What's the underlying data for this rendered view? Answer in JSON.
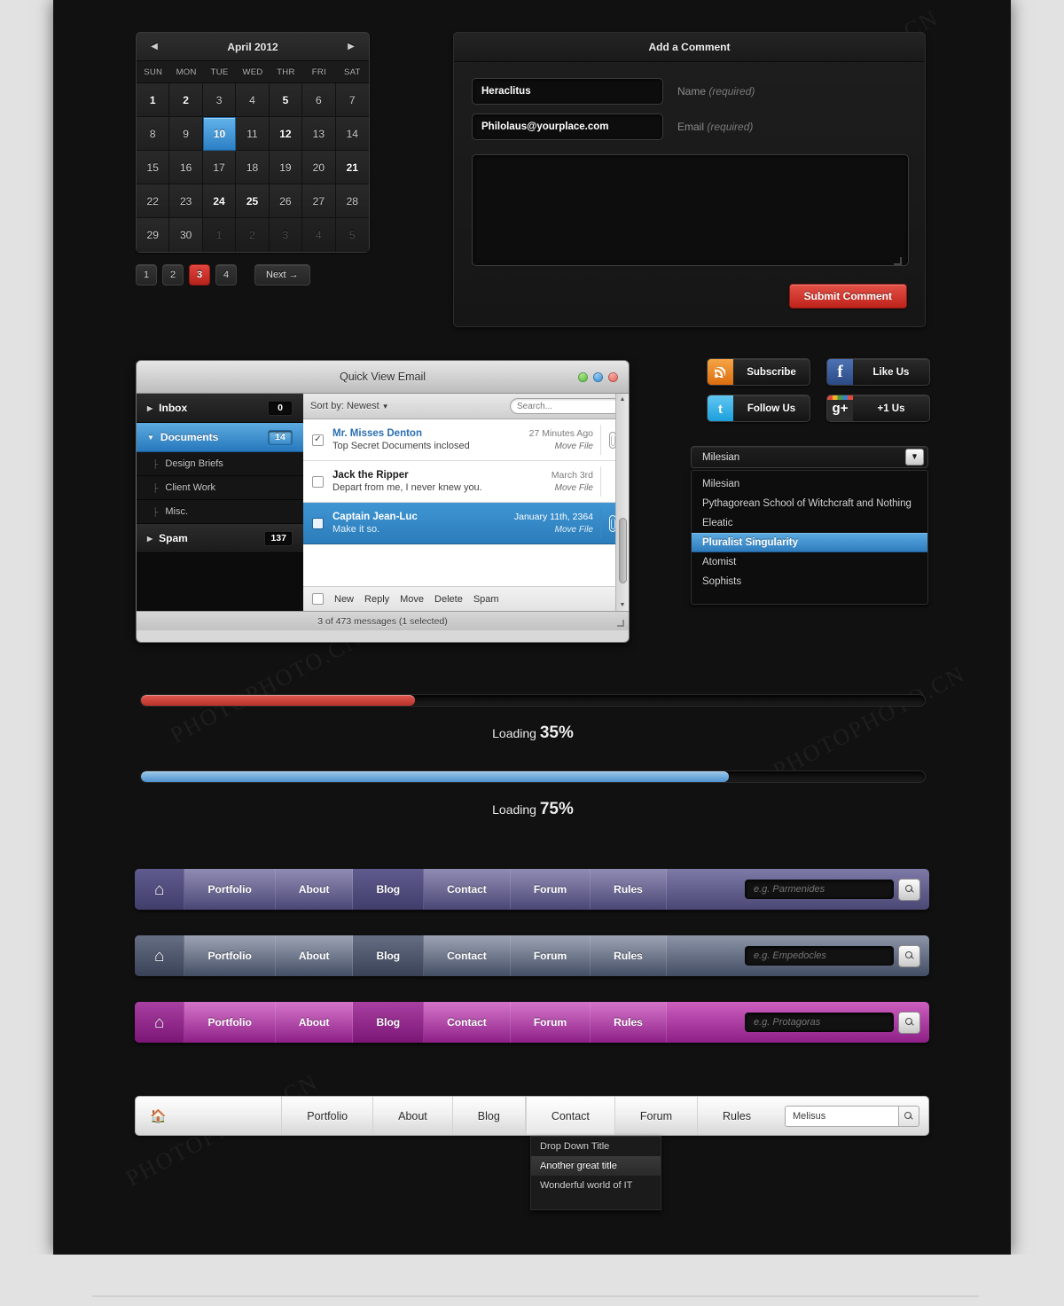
{
  "calendar": {
    "prev_icon": "triangle-left-icon",
    "next_icon": "triangle-right-icon",
    "title": "April 2012",
    "day_headers": [
      "SUN",
      "MON",
      "TUE",
      "WED",
      "THR",
      "FRI",
      "SAT"
    ],
    "weeks": [
      [
        {
          "d": "1",
          "s": "bold"
        },
        {
          "d": "2",
          "s": "bold"
        },
        {
          "d": "3",
          "s": ""
        },
        {
          "d": "4",
          "s": ""
        },
        {
          "d": "5",
          "s": "bold"
        },
        {
          "d": "6",
          "s": ""
        },
        {
          "d": "7",
          "s": ""
        }
      ],
      [
        {
          "d": "8",
          "s": ""
        },
        {
          "d": "9",
          "s": ""
        },
        {
          "d": "10",
          "s": "sel"
        },
        {
          "d": "11",
          "s": ""
        },
        {
          "d": "12",
          "s": "bold"
        },
        {
          "d": "13",
          "s": ""
        },
        {
          "d": "14",
          "s": ""
        }
      ],
      [
        {
          "d": "15",
          "s": ""
        },
        {
          "d": "16",
          "s": ""
        },
        {
          "d": "17",
          "s": ""
        },
        {
          "d": "18",
          "s": ""
        },
        {
          "d": "19",
          "s": ""
        },
        {
          "d": "20",
          "s": ""
        },
        {
          "d": "21",
          "s": "bold"
        }
      ],
      [
        {
          "d": "22",
          "s": ""
        },
        {
          "d": "23",
          "s": ""
        },
        {
          "d": "24",
          "s": "bold"
        },
        {
          "d": "25",
          "s": "bold"
        },
        {
          "d": "26",
          "s": ""
        },
        {
          "d": "27",
          "s": ""
        },
        {
          "d": "28",
          "s": ""
        }
      ],
      [
        {
          "d": "29",
          "s": ""
        },
        {
          "d": "30",
          "s": ""
        },
        {
          "d": "1",
          "s": "muted"
        },
        {
          "d": "2",
          "s": "muted"
        },
        {
          "d": "3",
          "s": "muted"
        },
        {
          "d": "4",
          "s": "muted"
        },
        {
          "d": "5",
          "s": "muted"
        }
      ]
    ],
    "selected_day": "10",
    "accent_selected": "#2c7fc4"
  },
  "pagination": {
    "pages": [
      "1",
      "2",
      "3",
      "4"
    ],
    "active_page": "3",
    "next_label": "Next →",
    "active_color": "#b6231c"
  },
  "comment_form": {
    "title": "Add a Comment",
    "name_value": "Heraclitus",
    "name_placeholder": "Name",
    "name_label": "Name",
    "name_hint": "(required)",
    "email_value": "Philolaus@yourplace.com",
    "email_placeholder": "Email",
    "email_label": "Email",
    "email_hint": "(required)",
    "message_value": "",
    "message_placeholder": "",
    "submit_label": "Submit Comment",
    "submit_color": "#bf231a"
  },
  "email_window": {
    "title": "Quick View Email",
    "window_buttons": [
      "minimize-dot",
      "maximize-dot",
      "close-dot"
    ],
    "sidebar": [
      {
        "type": "folder",
        "label": "Inbox",
        "badge": "0",
        "active": false,
        "caret": "▶"
      },
      {
        "type": "folder",
        "label": "Documents",
        "badge": "14",
        "active": true,
        "caret": "▼"
      },
      {
        "type": "sub",
        "label": "Design Briefs"
      },
      {
        "type": "sub",
        "label": "Client Work"
      },
      {
        "type": "sub",
        "label": "Misc."
      },
      {
        "type": "folder",
        "label": "Spam",
        "badge": "137",
        "active": false,
        "caret": "▶"
      }
    ],
    "toolbar": {
      "sort_label": "Sort by: Newest",
      "search_placeholder": "Search..."
    },
    "messages": [
      {
        "from": "Mr. Misses Denton",
        "subject": "Top Secret Documents inclosed",
        "date": "27 Minutes Ago",
        "move": "Move File",
        "checked": true,
        "selected": false,
        "unread": false,
        "clip": true
      },
      {
        "from": "Jack the Ripper",
        "subject": "Depart from me, I never knew you.",
        "date": "March 3rd",
        "move": "Move File",
        "checked": false,
        "selected": false,
        "unread": true,
        "clip": false
      },
      {
        "from": "Captain Jean-Luc",
        "subject": "Make it so.",
        "date": "January 11th, 2364",
        "move": "Move File",
        "checked": false,
        "selected": true,
        "unread": false,
        "clip": true
      }
    ],
    "actions": [
      "New",
      "Reply",
      "Move",
      "Delete",
      "Spam"
    ],
    "status": "3 of 473 messages (1 selected)"
  },
  "social_buttons": [
    {
      "label": "Subscribe",
      "icon": "rss-icon",
      "cls": "rss",
      "glyph": ""
    },
    {
      "label": "Like Us",
      "icon": "facebook-icon",
      "cls": "fb",
      "glyph": "f"
    },
    {
      "label": "Follow Us",
      "icon": "twitter-icon",
      "cls": "tw",
      "glyph": "t"
    },
    {
      "label": "+1 Us",
      "icon": "google-plus-icon",
      "cls": "gp",
      "glyph": "g+"
    }
  ],
  "select_widget": {
    "value": "Milesian",
    "caret_icon": "chevron-down-icon",
    "options": [
      {
        "label": "Milesian",
        "selected": false
      },
      {
        "label": "Pythagorean School of Witchcraft and Nothing",
        "selected": false
      },
      {
        "label": "Eleatic",
        "selected": false
      },
      {
        "label": "Pluralist Singularity",
        "selected": true
      },
      {
        "label": "Atomist",
        "selected": false
      },
      {
        "label": "Sophists",
        "selected": false
      }
    ]
  },
  "progress_bars": [
    {
      "label": "Loading",
      "percent": "35%",
      "value": 35,
      "color": "#b8322a",
      "variant": "red"
    },
    {
      "label": "Loading",
      "percent": "75%",
      "value": 75,
      "color": "#4f93cf",
      "variant": "blue"
    }
  ],
  "navbars": [
    {
      "theme": "purple",
      "accent": "#4b4775",
      "home_icon": "home-icon",
      "items": [
        {
          "label": "Portfolio",
          "active": false
        },
        {
          "label": "About",
          "active": false
        },
        {
          "label": "Blog",
          "active": true
        },
        {
          "label": "Contact",
          "active": false
        },
        {
          "label": "Forum",
          "active": false
        },
        {
          "label": "Rules",
          "active": false
        }
      ],
      "search_placeholder": "e.g. Parmenides",
      "search_icon": "search-icon"
    },
    {
      "theme": "slate",
      "accent": "#434d63",
      "home_icon": "home-icon",
      "items": [
        {
          "label": "Portfolio",
          "active": false
        },
        {
          "label": "About",
          "active": false
        },
        {
          "label": "Blog",
          "active": true
        },
        {
          "label": "Contact",
          "active": false
        },
        {
          "label": "Forum",
          "active": false
        },
        {
          "label": "Rules",
          "active": false
        }
      ],
      "search_placeholder": "e.g. Empedocles",
      "search_icon": "search-icon"
    },
    {
      "theme": "magenta",
      "accent": "#8d1f87",
      "home_icon": "home-icon",
      "items": [
        {
          "label": "Portfolio",
          "active": false
        },
        {
          "label": "About",
          "active": false
        },
        {
          "label": "Blog",
          "active": true
        },
        {
          "label": "Contact",
          "active": false
        },
        {
          "label": "Forum",
          "active": false
        },
        {
          "label": "Rules",
          "active": false
        }
      ],
      "search_placeholder": "e.g. Protagoras",
      "search_icon": "search-icon"
    }
  ],
  "white_navbar": {
    "home_icon": "home-icon",
    "items": [
      {
        "label": "Portfolio",
        "active": false
      },
      {
        "label": "About",
        "active": false
      },
      {
        "label": "Blog",
        "active": false
      },
      {
        "label": "Contact",
        "active": true
      },
      {
        "label": "Forum",
        "active": false
      },
      {
        "label": "Rules",
        "active": false
      }
    ],
    "search_value": "Melisus",
    "search_placeholder": "",
    "search_icon": "search-icon",
    "dropdown": [
      {
        "label": "Drop Down Title",
        "hover": false
      },
      {
        "label": "Another great title",
        "hover": true
      },
      {
        "label": "Wonderful world of IT",
        "hover": false
      }
    ]
  }
}
